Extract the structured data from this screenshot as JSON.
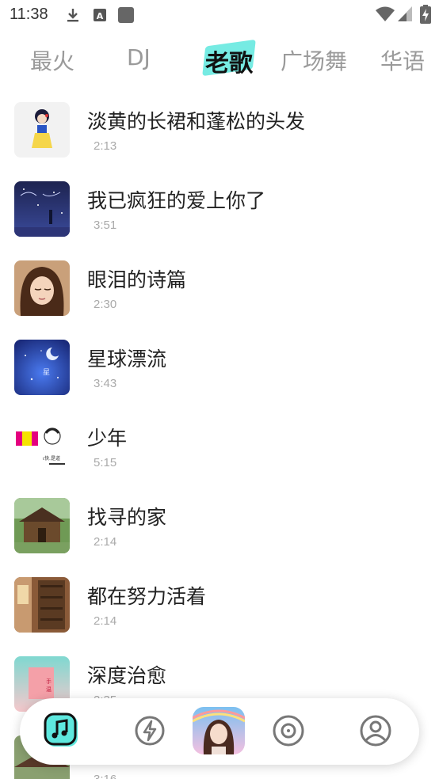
{
  "status_bar": {
    "time": "11:38"
  },
  "tabs": [
    {
      "label": "最火"
    },
    {
      "label": "DJ"
    },
    {
      "label": "老歌"
    },
    {
      "label": "广场舞"
    },
    {
      "label": "华语"
    }
  ],
  "active_tab": "老歌",
  "songs": [
    {
      "title": "淡黄的长裙和蓬松的头发",
      "duration": "2:13"
    },
    {
      "title": "我已疯狂的爱上你了",
      "duration": "3:51"
    },
    {
      "title": "眼泪的诗篇",
      "duration": "2:30"
    },
    {
      "title": "星球漂流",
      "duration": "3:43"
    },
    {
      "title": "少年",
      "duration": "5:15"
    },
    {
      "title": "找寻的家",
      "duration": "2:14"
    },
    {
      "title": "都在努力活着",
      "duration": "2:14"
    },
    {
      "title": "深度治愈",
      "duration": "2:35"
    },
    {
      "title": "",
      "duration": "3:16"
    }
  ],
  "accent_color": "#5ee8de",
  "bottom_nav": [
    "music-icon",
    "lightning-icon",
    "now-playing-cover",
    "disc-icon",
    "profile-icon"
  ]
}
